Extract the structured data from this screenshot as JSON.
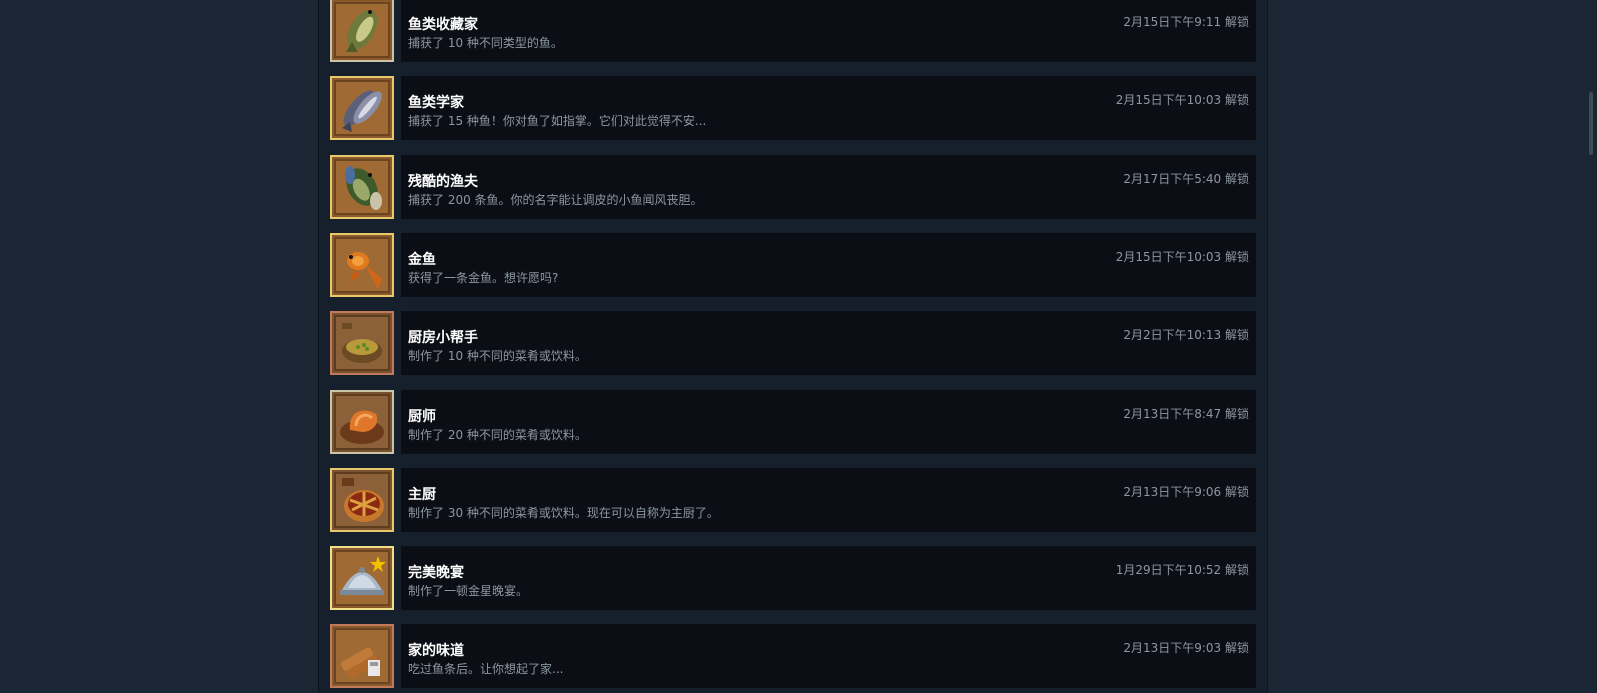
{
  "achievements": [
    {
      "title": "鱼类收藏家",
      "description": "捕获了 10 种不同类型的鱼。",
      "unlock_time": "2月15日下午9:11 解锁",
      "icon": "fish-collector-icon",
      "frame_color": "#c9c4a8",
      "bg_color": "#8a5a2e"
    },
    {
      "title": "鱼类学家",
      "description": "捕获了 15 种鱼！你对鱼了如指掌。它们对此觉得不安...",
      "unlock_time": "2月15日下午10:03 解锁",
      "icon": "ichthyologist-icon",
      "frame_color": "#e8c96a",
      "bg_color": "#8a5a2e"
    },
    {
      "title": "残酷的渔夫",
      "description": "捕获了 200 条鱼。你的名字能让调皮的小鱼闻风丧胆。",
      "unlock_time": "2月17日下午5:40 解锁",
      "icon": "ruthless-fisherman-icon",
      "frame_color": "#e8c96a",
      "bg_color": "#8a5a2e"
    },
    {
      "title": "金鱼",
      "description": "获得了一条金鱼。想许愿吗?",
      "unlock_time": "2月15日下午10:03 解锁",
      "icon": "goldfish-icon",
      "frame_color": "#e8c96a",
      "bg_color": "#8a5a2e"
    },
    {
      "title": "厨房小帮手",
      "description": "制作了 10 种不同的菜肴或饮料。",
      "unlock_time": "2月2日下午10:13 解锁",
      "icon": "kitchen-helper-icon",
      "frame_color": "#c07a5c",
      "bg_color": "#7a5230"
    },
    {
      "title": "厨师",
      "description": "制作了 20 种不同的菜肴或饮料。",
      "unlock_time": "2月13日下午8:47 解锁",
      "icon": "cook-icon",
      "frame_color": "#c9c4a8",
      "bg_color": "#7a5230"
    },
    {
      "title": "主厨",
      "description": "制作了 30 种不同的菜肴或饮料。现在可以自称为主厨了。",
      "unlock_time": "2月13日下午9:06 解锁",
      "icon": "head-chef-icon",
      "frame_color": "#e8c96a",
      "bg_color": "#7a5230"
    },
    {
      "title": "完美晚宴",
      "description": "制作了一顿金星晚宴。",
      "unlock_time": "1月29日下午10:52 解锁",
      "icon": "perfect-dinner-icon",
      "frame_color": "#f0e08a",
      "bg_color": "#8a5a2e"
    },
    {
      "title": "家的味道",
      "description": "吃过鱼条后。让你想起了家...",
      "unlock_time": "2月13日下午9:03 解锁",
      "icon": "taste-of-home-icon",
      "frame_color": "#c07a5c",
      "bg_color": "#8a5a2e"
    }
  ]
}
